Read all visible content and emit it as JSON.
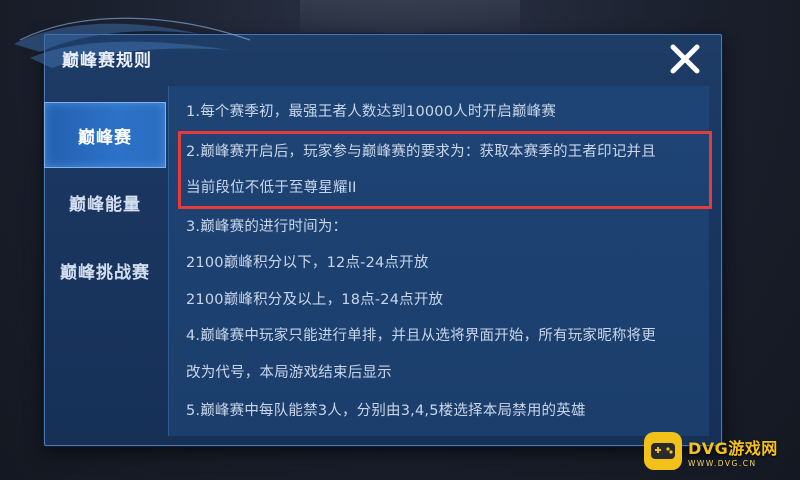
{
  "dialog": {
    "title": "巅峰赛规则",
    "close_icon": "close-icon"
  },
  "sidebar": {
    "tabs": [
      {
        "label": "巅峰赛",
        "active": true
      },
      {
        "label": "巅峰能量",
        "active": false
      },
      {
        "label": "巅峰挑战赛",
        "active": false
      }
    ]
  },
  "rules": [
    "1.每个赛季初，最强王者人数达到10000人时开启巅峰赛",
    "2.巅峰赛开启后，玩家参与巅峰赛的要求为：获取本赛季的王者印记并且",
    "当前段位不低于至尊星耀II",
    "3.巅峰赛的进行时间为：",
    "2100巅峰积分以下，12点-24点开放",
    "2100巅峰积分及以上，18点-24点开放",
    "4.巅峰赛中玩家只能进行单排，并且从选将界面开始，所有玩家昵称将更",
    "改为代号，本局游戏结束后显示",
    "5.巅峰赛中每队能禁3人，分别由3,4,5楼选择本局禁用的英雄"
  ],
  "colors": {
    "highlight_border": "#e53b3b",
    "active_tab": "#2c72c8"
  },
  "watermark": {
    "main": "DVG游戏网",
    "sub": "WWW.DVG.CN"
  }
}
